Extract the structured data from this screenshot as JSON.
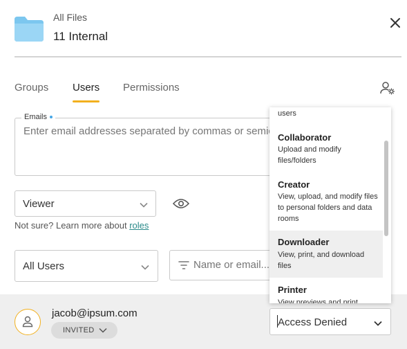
{
  "header": {
    "breadcrumb": "All Files",
    "title": "11 Internal",
    "icons": {
      "folder": "folder-icon",
      "close": "close-icon"
    }
  },
  "tabs": [
    {
      "label": "Groups",
      "active": false
    },
    {
      "label": "Users",
      "active": true
    },
    {
      "label": "Permissions",
      "active": false
    }
  ],
  "emails": {
    "label": "Emails",
    "placeholder": "Enter email addresses separated by commas or semicolons"
  },
  "role_select": {
    "value": "Viewer"
  },
  "help": {
    "text": "Not sure? Learn more about ",
    "link": "roles"
  },
  "users_filter": {
    "value": "All Users"
  },
  "name_search": {
    "placeholder": "Name or email..."
  },
  "user_row": {
    "email": "jacob@ipsum.com",
    "status": "INVITED",
    "access": "Access Denied"
  },
  "dropdown": {
    "items": [
      {
        "title": "",
        "desc": "users"
      },
      {
        "title": "Collaborator",
        "desc": "Upload and modify files/folders"
      },
      {
        "title": "Creator",
        "desc": "View, upload, and modify files to personal folders and data rooms"
      },
      {
        "title": "Downloader",
        "desc": "View, print, and download files"
      },
      {
        "title": "Printer",
        "desc": "View previews and print"
      }
    ]
  },
  "colors": {
    "accent": "#f2b01e",
    "link": "#2a8a8a",
    "required_dot": "#46a6e6",
    "folder": "#7cc7ef"
  }
}
